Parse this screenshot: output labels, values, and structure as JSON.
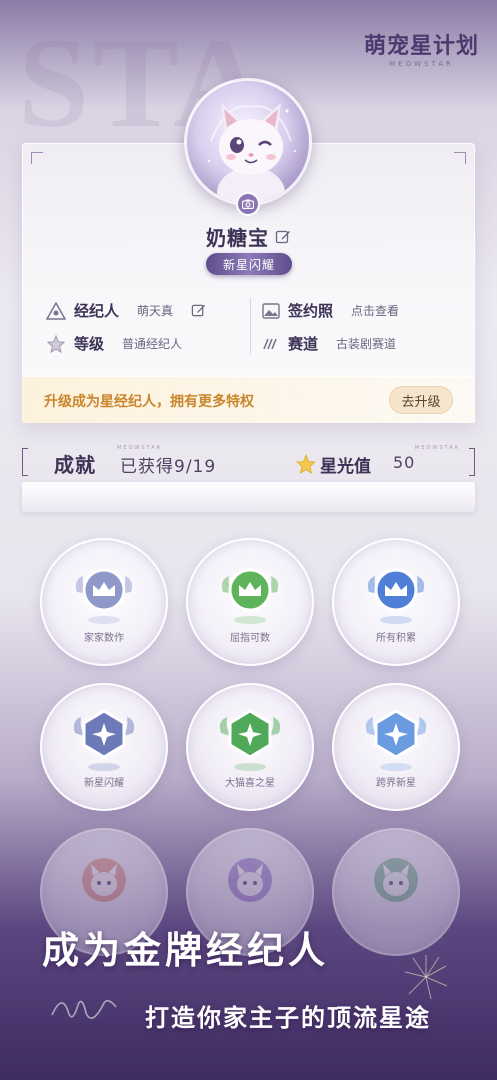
{
  "background_text": "STA",
  "logo": {
    "title": "萌宠星计划",
    "subtitle": "MEOWSTAR"
  },
  "profile": {
    "name": "奶糖宝",
    "badge": "新星闪耀",
    "info": [
      {
        "key": "经纪人",
        "value": "萌天真",
        "icon": "agent-icon"
      },
      {
        "key": "签约照",
        "value": "点击查看",
        "icon": "photo-icon"
      },
      {
        "key": "等级",
        "value": "普通经纪人",
        "icon": "star-outline-icon"
      },
      {
        "key": "赛道",
        "value": "古装剧赛道",
        "icon": "track-icon"
      }
    ]
  },
  "upgrade": {
    "text": "升级成为星经纪人，拥有更多特权",
    "button": "去升级"
  },
  "achievements": {
    "title": "成就",
    "count": "已获得9/19",
    "star_label": "星光值",
    "star_value": "50",
    "deco": "MEOWSTAR",
    "medals": [
      {
        "label": "家家数作",
        "color": "#8e98c9",
        "shape": "crown"
      },
      {
        "label": "屈指可数",
        "color": "#5fb35a",
        "shape": "crown"
      },
      {
        "label": "所有积累",
        "color": "#4f7fd6",
        "shape": "crown"
      },
      {
        "label": "新星闪耀",
        "color": "#6c7bb8",
        "shape": "shield"
      },
      {
        "label": "大猫喜之星",
        "color": "#4fa958",
        "shape": "shield"
      },
      {
        "label": "跨界新星",
        "color": "#6a9be0",
        "shape": "shield"
      },
      {
        "label": "",
        "color": "#e07d6a",
        "shape": "pet"
      },
      {
        "label": "",
        "color": "#8c6ac8",
        "shape": "pet"
      },
      {
        "label": "",
        "color": "#5fae7a",
        "shape": "pet"
      }
    ]
  },
  "slogan": {
    "line1": "成为金牌经纪人",
    "line2": "打造你家主子的顶流星途"
  },
  "colors": {
    "accent": "#8a76b3",
    "upgrade_text": "#c9862c"
  }
}
